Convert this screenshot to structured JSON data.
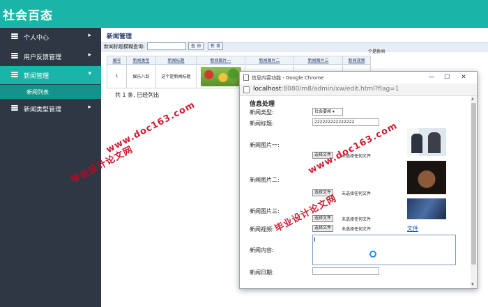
{
  "header": {
    "title": "社会百态"
  },
  "sidebar": {
    "items": [
      {
        "label": "个人中心",
        "arrow": "▸"
      },
      {
        "label": "用户反馈管理",
        "arrow": "▸"
      },
      {
        "label": "新闻管理",
        "arrow": "▾"
      },
      {
        "label": "新闻类型管理",
        "arrow": "▸"
      }
    ],
    "sub_item": "新闻列表"
  },
  "main": {
    "title": "新闻管理",
    "search": {
      "label": "新闻标题模糊查询:",
      "value": "",
      "query_button": "查 询",
      "add_button": "新 增"
    },
    "table": {
      "columns": [
        "编号",
        "新闻类型",
        "新闻标题",
        "新闻图片一",
        "新闻图片二",
        "新闻图片三",
        "新闻视频"
      ],
      "rows": [
        {
          "id": "1",
          "type": "娱乐八卦",
          "title": "这个是新闻标题"
        }
      ]
    },
    "summary": "共 1 条, 已经列出",
    "overflow_text": "个是新闻"
  },
  "popup": {
    "window_title": "信息内容功能 - Google Chrome",
    "url_host": "localhost",
    "url_rest": ":8080/m8/admin/xw/edit.html?flag=1",
    "controls": {
      "minimize": "—",
      "maximize": "☐",
      "close": "✕"
    },
    "form": {
      "title": "信息处理",
      "type_label": "新闻类型:",
      "type_value": "社会要闻 ▾",
      "title_label": "新闻标题:",
      "title_value": "222222222222222",
      "image1_label": "新闻图片一:",
      "image2_label": "新闻图片二:",
      "image3_label": "新闻图片三:",
      "video_label": "新闻视频:",
      "content_label": "新闻内容:",
      "date_label": "新闻日期:",
      "date_value": "",
      "choose_file": "选择文件",
      "no_file": "未选择任何文件",
      "video_link": "文件"
    }
  },
  "watermarks": {
    "site": "www.doc163.com",
    "brand": "毕业设计论文网"
  }
}
